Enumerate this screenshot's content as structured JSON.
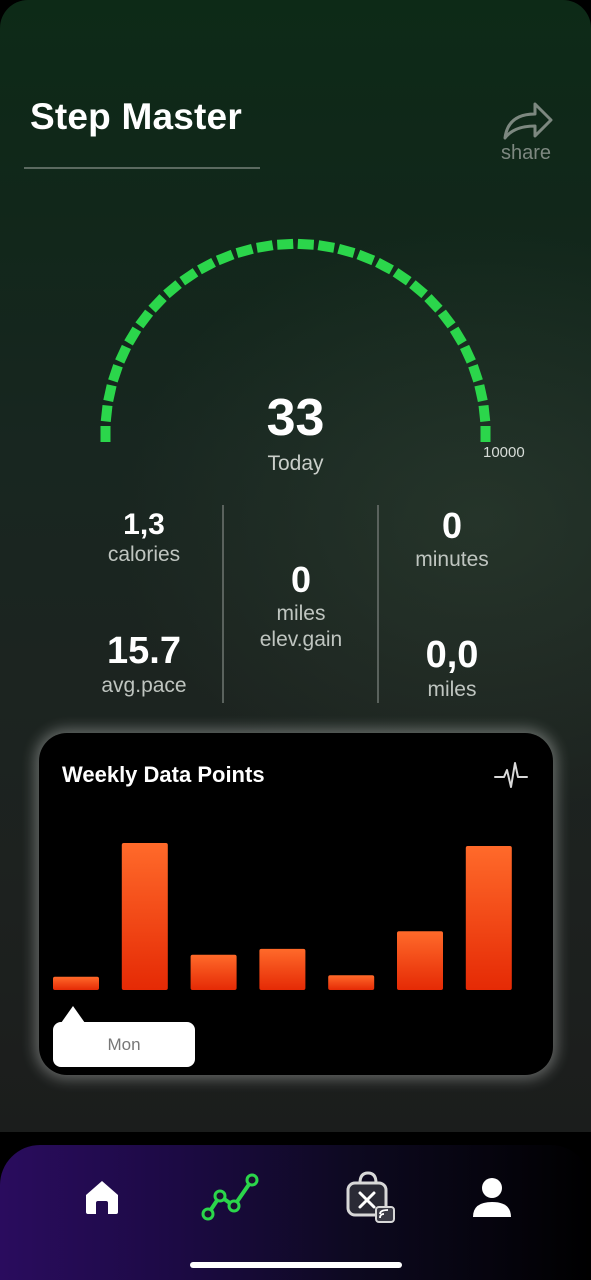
{
  "app": {
    "title": "Step Master",
    "share_label": "share"
  },
  "gauge": {
    "steps": "33",
    "caption": "Today",
    "max_label": "10000",
    "goal": 10000,
    "accent_color": "#2bd64b"
  },
  "stats": {
    "calories": {
      "value": "1,3",
      "label": "calories"
    },
    "avg_pace": {
      "value": "15.7",
      "label": "avg.pace"
    },
    "elev_gain": {
      "value": "0",
      "label_line1": "miles",
      "label_line2": "elev.gain"
    },
    "minutes": {
      "value": "0",
      "label": "minutes"
    },
    "distance": {
      "value": "0,0",
      "label": "miles"
    }
  },
  "weekly": {
    "title": "Weekly Data Points",
    "icon": "heartbeat-icon",
    "tooltip_day": "Mon",
    "bar_color_top": "#ff6a2a",
    "bar_color_bottom": "#e52a05"
  },
  "chart_data": {
    "type": "bar",
    "title": "Weekly Data Points",
    "series": [
      {
        "values": [
          0.09,
          1.0,
          0.24,
          0.28,
          0.1,
          0.4,
          0.98
        ]
      }
    ],
    "highlighted_index": 0
  },
  "tabbar": {
    "items": [
      {
        "icon": "home-icon",
        "active": false
      },
      {
        "icon": "activity-chart-icon",
        "active": true
      },
      {
        "icon": "shopping-bag-cast-icon",
        "active": false
      },
      {
        "icon": "profile-icon",
        "active": false
      }
    ],
    "active_color": "#2bd64b"
  }
}
